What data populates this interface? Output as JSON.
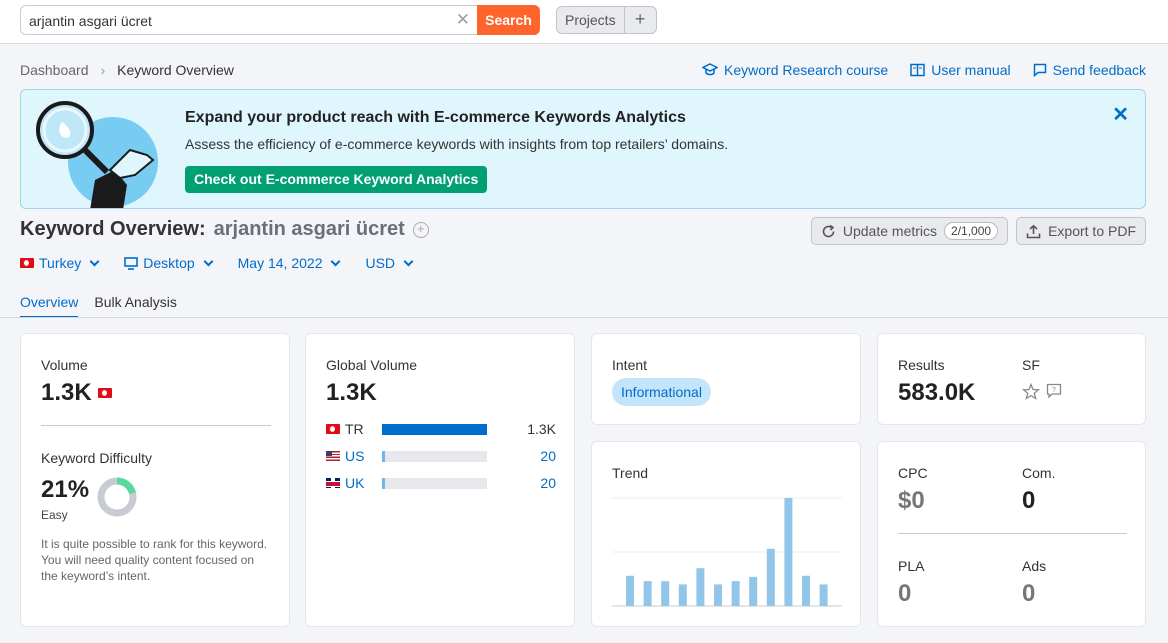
{
  "search": {
    "value": "arjantin asgari ücret",
    "button": "Search"
  },
  "projects": {
    "label": "Projects",
    "add": "+"
  },
  "breadcrumb": {
    "root": "Dashboard",
    "current": "Keyword Overview"
  },
  "links": {
    "course": "Keyword Research course",
    "manual": "User manual",
    "feedback": "Send feedback"
  },
  "banner": {
    "title": "Expand your product reach with E-commerce Keywords Analytics",
    "text": "Assess the efficiency of e-commerce keywords with insights from top retailers’ domains.",
    "button": "Check out E-commerce Keyword Analytics"
  },
  "page": {
    "title": "Keyword Overview:",
    "keyword": "arjantin asgari ücret"
  },
  "actions": {
    "update": "Update metrics",
    "counter": "2/1,000",
    "export": "Export to PDF"
  },
  "filters": {
    "country": "Turkey",
    "device": "Desktop",
    "date": "May 14, 2022",
    "currency": "USD"
  },
  "tabs": [
    "Overview",
    "Bulk Analysis"
  ],
  "volume": {
    "label": "Volume",
    "value": "1.3K"
  },
  "kd": {
    "label": "Keyword Difficulty",
    "value": "21%",
    "level": "Easy",
    "percent": 21,
    "description": "It is quite possible to rank for this keyword. You will need quality content focused on the keyword’s intent."
  },
  "global_volume": {
    "label": "Global Volume",
    "value": "1.3K",
    "rows": [
      {
        "country": "TR",
        "value": "1.3K",
        "fraction": 1.0
      },
      {
        "country": "US",
        "value": "20",
        "fraction": 0.02
      },
      {
        "country": "UK",
        "value": "20",
        "fraction": 0.02
      }
    ]
  },
  "intent": {
    "label": "Intent",
    "value": "Informational"
  },
  "results": {
    "label": "Results",
    "value": "583.0K"
  },
  "sf": {
    "label": "SF"
  },
  "trend": {
    "label": "Trend"
  },
  "chart_data": {
    "type": "bar",
    "title": "Trend",
    "values": [
      0.28,
      0.23,
      0.23,
      0.2,
      0.35,
      0.2,
      0.23,
      0.27,
      0.53,
      1.0,
      0.28,
      0.2
    ],
    "ylim": [
      0,
      1
    ]
  },
  "cpc": {
    "label": "CPC",
    "value": "$0"
  },
  "com": {
    "label": "Com.",
    "value": "0"
  },
  "pla": {
    "label": "PLA",
    "value": "0"
  },
  "ads": {
    "label": "Ads",
    "value": "0"
  },
  "colors": {
    "accent": "#006dca",
    "search": "#ff642d",
    "cta": "#00a073",
    "banner_bg": "#e0f6fd",
    "trend_bar": "#91c6ea"
  }
}
